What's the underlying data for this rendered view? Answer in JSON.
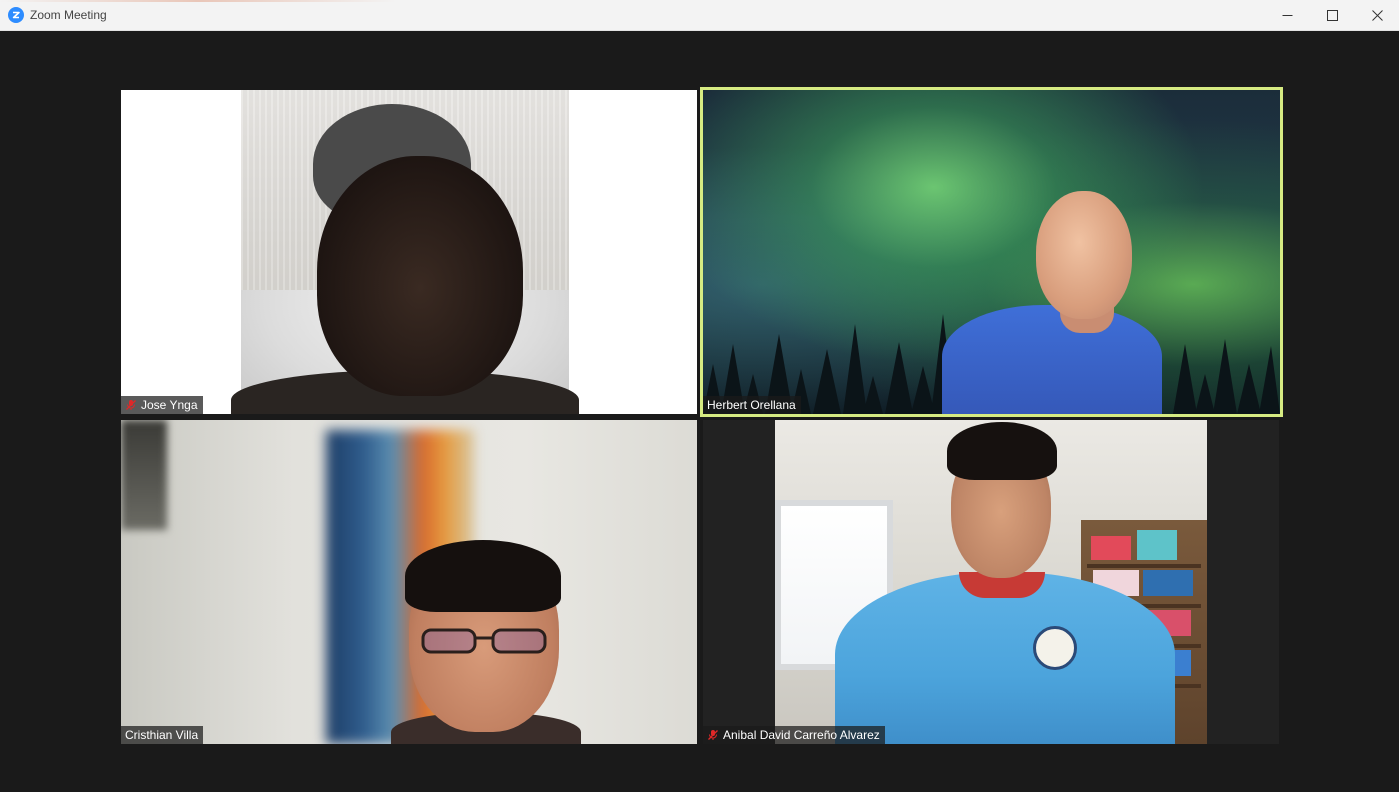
{
  "window": {
    "title": "Zoom Meeting"
  },
  "participants": [
    {
      "name": "Jose Ynga",
      "muted": true,
      "active_speaker": false
    },
    {
      "name": "Herbert Orellana",
      "muted": false,
      "active_speaker": true
    },
    {
      "name": "Cristhian Villa",
      "muted": false,
      "active_speaker": false
    },
    {
      "name": "Anibal David Carreño Alvarez",
      "muted": true,
      "active_speaker": false
    }
  ],
  "colors": {
    "background": "#1a1a1a",
    "active_speaker_border": "#d6eb82",
    "zoom_blue": "#2d8cff",
    "mute_red": "#e02828"
  },
  "icons": {
    "app": "zoom-logo-icon",
    "minimize": "minimize-icon",
    "maximize": "maximize-icon",
    "close": "close-icon",
    "mute": "microphone-muted-icon"
  }
}
